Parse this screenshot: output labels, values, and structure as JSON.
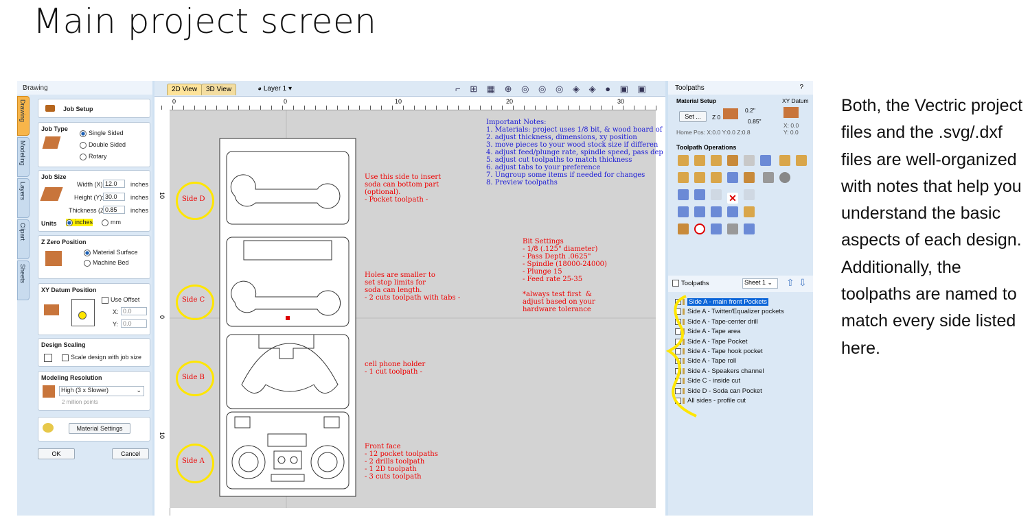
{
  "slide": {
    "title": "Main project screen",
    "description": "Both, the Vectric project files and the .svg/.dxf files are well-organized with notes that help you understand the basic aspects of each design. Additionally, the toolpaths are named to match every side listed here."
  },
  "left_panel": {
    "header": "Drawing",
    "header_tools": "?",
    "tabs": [
      "Drawing",
      "Modeling",
      "Layers",
      "Clipart",
      "Sheets"
    ],
    "job_setup": "Job Setup",
    "job_type": {
      "title": "Job Type",
      "options": [
        "Single Sided",
        "Double Sided",
        "Rotary"
      ],
      "selected": "Single Sided"
    },
    "job_size": {
      "title": "Job Size",
      "width_label": "Width (X):",
      "width": "12.0",
      "height_label": "Height (Y):",
      "height": "30.0",
      "thickness_label": "Thickness (Z):",
      "thickness": "0.85",
      "unit": "inches",
      "units_label": "Units",
      "units_options": [
        "inches",
        "mm"
      ],
      "units_selected": "inches"
    },
    "z_zero": {
      "title": "Z Zero Position",
      "options": [
        "Material Surface",
        "Machine Bed"
      ],
      "selected": "Material Surface"
    },
    "xy_datum": {
      "title": "XY Datum Position",
      "use_offset": "Use Offset",
      "x_label": "X:",
      "x": "0.0",
      "y_label": "Y:",
      "y": "0.0"
    },
    "design_scaling": {
      "title": "Design Scaling",
      "checkbox": "Scale design with job size"
    },
    "modeling_resolution": {
      "title": "Modeling Resolution",
      "value": "High (3 x Slower)",
      "sub": "2 million points"
    },
    "material_settings": "Material Settings",
    "ok": "OK",
    "cancel": "Cancel"
  },
  "center": {
    "tabs": [
      "2D View",
      "3D View"
    ],
    "layer": "Layer 1",
    "ruler_h": [
      "0",
      "0",
      "10",
      "20",
      "30"
    ],
    "ruler_v": [
      "10",
      "0",
      "10"
    ],
    "notes": {
      "important": "Important Notes:\n1. Materials: project uses 1/8 bit, & wood board of\n2. adjust thickness, dimensions, xy position\n3. move pieces to your wood stock size if differen\n4. adjust feed/plunge rate, spindle speed, pass dep\n5. adjust cut toolpaths to match thickness\n6. adjust tabs to your preference\n7. Ungroup some items if needed for changes\n8. Preview toolpaths",
      "soda": "Use this side to insert\nsoda can bottom part\n(optional).\n- Pocket toolpath -",
      "bit": "Bit Settings\n- 1/8 (.125\" diameter)\n- Pass Depth .0625\"\n- Spindle (18000-24000)\n- Plunge 15\n- Feed rate 25-35\n\n*always test first  &\nadjust based on your\nhardware tolerance",
      "holes": "Holes are smaller to\nset stop limits for\nsoda can length.\n- 2 cuts toolpath with tabs -",
      "phone": "cell phone holder\n- 1 cut toolpath -",
      "front": "Front face\n- 12 pocket toolpaths\n- 2 drills toolpath\n- 1 2D toolpath\n- 3 cuts toolpath"
    },
    "side_labels": [
      "Side D",
      "Side C",
      "Side B",
      "Side A"
    ]
  },
  "right_panel": {
    "header": "Toolpaths",
    "header_tools": "?",
    "material_setup": "Material Setup",
    "set_button": "Set ...",
    "z_label": "Z 0",
    "dim_top": "0.2\"",
    "dim_bottom": "0.85\"",
    "home_pos": "Home Pos:  X:0.0 Y:0.0 Z:0.8",
    "xy_datum": "XY Datum",
    "xy_x": "X: 0.0",
    "xy_y": "Y: 0.0",
    "operations": "Toolpath Operations",
    "toolpaths_label": "Toolpaths",
    "sheet": "Sheet 1",
    "list": [
      "Side A - main front Pockets",
      "Side A - Twitter/Equalizer pockets",
      "Side A - Tape-center drill",
      "Side A - Tape area",
      "Side A - Tape Pocket",
      "Side A - Tape hook pocket",
      "Side A - Tape roll",
      "Side A - Speakers channel",
      "Side C - inside cut",
      "Side D - Soda can Pocket",
      "All sides - profile cut"
    ]
  },
  "colors": {
    "highlight": "#ffe600",
    "note_red": "#e00000",
    "note_blue": "#1a1ad6",
    "panel": "#dbe8f5"
  }
}
